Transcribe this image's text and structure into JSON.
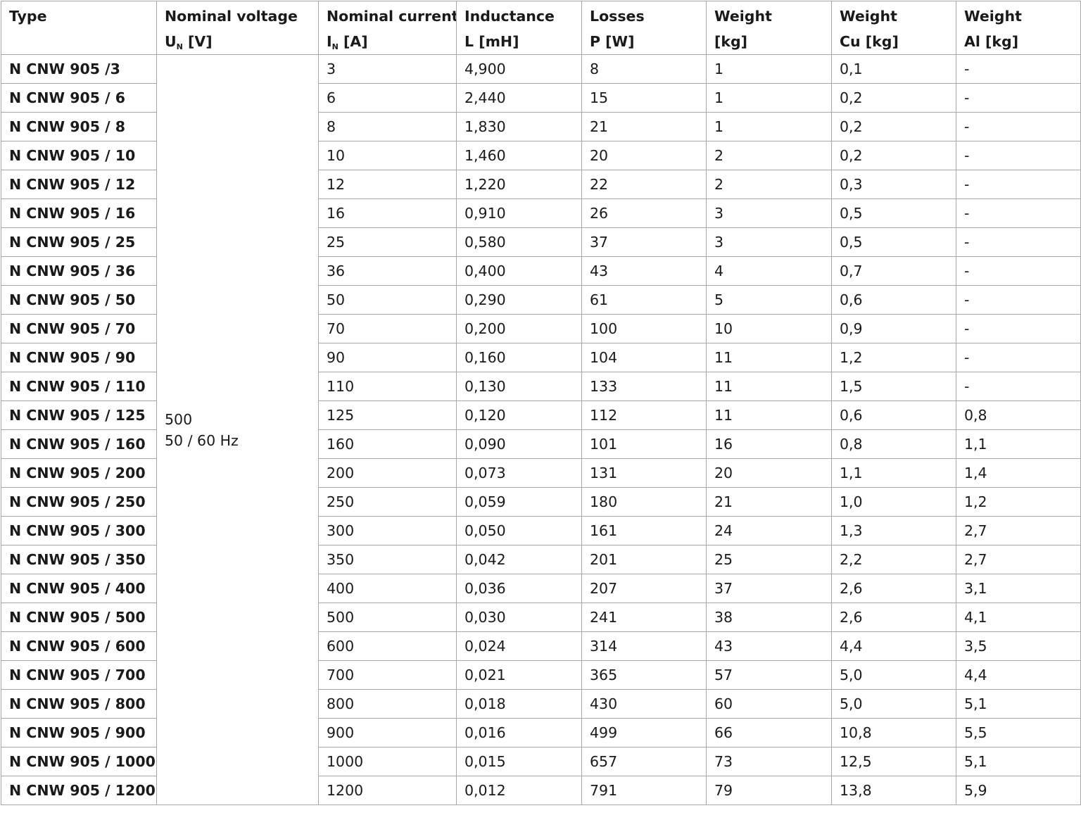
{
  "headers": [
    {
      "line1": "Type",
      "line2": "",
      "sub": "",
      "line2_rest": ""
    },
    {
      "line1": "Nominal voltage",
      "line2": "U",
      "sub": "N",
      "line2_rest": " [V]"
    },
    {
      "line1": "Nominal current",
      "line2": "I",
      "sub": "N",
      "line2_rest": " [A]"
    },
    {
      "line1": "Inductance",
      "line2": "L [mH]",
      "sub": "",
      "line2_rest": ""
    },
    {
      "line1": "Losses",
      "line2": "P [W]",
      "sub": "",
      "line2_rest": ""
    },
    {
      "line1": "Weight",
      "line2": "[kg]",
      "sub": "",
      "line2_rest": ""
    },
    {
      "line1": "Weight",
      "line2": "Cu [kg]",
      "sub": "",
      "line2_rest": ""
    },
    {
      "line1": "Weight",
      "line2": "Al [kg]",
      "sub": "",
      "line2_rest": ""
    }
  ],
  "voltage": {
    "value": "500",
    "frequency": "50 / 60 Hz"
  },
  "rows": [
    {
      "type": "N CNW 905 /3",
      "current": "3",
      "inductance": "4,900",
      "losses": "8",
      "weight": "1",
      "cu": "0,1",
      "al": "-"
    },
    {
      "type": "N CNW 905 / 6",
      "current": "6",
      "inductance": "2,440",
      "losses": "15",
      "weight": "1",
      "cu": "0,2",
      "al": "-"
    },
    {
      "type": "N CNW 905 / 8",
      "current": "8",
      "inductance": "1,830",
      "losses": "21",
      "weight": "1",
      "cu": "0,2",
      "al": "-"
    },
    {
      "type": "N CNW 905 / 10",
      "current": "10",
      "inductance": "1,460",
      "losses": "20",
      "weight": "2",
      "cu": "0,2",
      "al": "-"
    },
    {
      "type": "N CNW 905 / 12",
      "current": "12",
      "inductance": "1,220",
      "losses": "22",
      "weight": "2",
      "cu": "0,3",
      "al": "-"
    },
    {
      "type": "N CNW 905 / 16",
      "current": "16",
      "inductance": "0,910",
      "losses": "26",
      "weight": "3",
      "cu": "0,5",
      "al": "-"
    },
    {
      "type": "N CNW 905 / 25",
      "current": "25",
      "inductance": "0,580",
      "losses": "37",
      "weight": "3",
      "cu": "0,5",
      "al": "-"
    },
    {
      "type": "N CNW 905 / 36",
      "current": "36",
      "inductance": "0,400",
      "losses": "43",
      "weight": "4",
      "cu": "0,7",
      "al": "-"
    },
    {
      "type": "N CNW 905 / 50",
      "current": "50",
      "inductance": "0,290",
      "losses": "61",
      "weight": "5",
      "cu": "0,6",
      "al": "-"
    },
    {
      "type": "N CNW 905 / 70",
      "current": "70",
      "inductance": "0,200",
      "losses": "100",
      "weight": "10",
      "cu": "0,9",
      "al": "-"
    },
    {
      "type": "N CNW 905 / 90",
      "current": "90",
      "inductance": "0,160",
      "losses": "104",
      "weight": "11",
      "cu": "1,2",
      "al": "-"
    },
    {
      "type": "N CNW 905 / 110",
      "current": "110",
      "inductance": "0,130",
      "losses": "133",
      "weight": "11",
      "cu": "1,5",
      "al": "-"
    },
    {
      "type": "N CNW 905 / 125",
      "current": "125",
      "inductance": "0,120",
      "losses": "112",
      "weight": "11",
      "cu": "0,6",
      "al": "0,8"
    },
    {
      "type": "N CNW 905 / 160",
      "current": "160",
      "inductance": "0,090",
      "losses": "101",
      "weight": "16",
      "cu": "0,8",
      "al": "1,1"
    },
    {
      "type": "N CNW 905 / 200",
      "current": "200",
      "inductance": "0,073",
      "losses": "131",
      "weight": "20",
      "cu": "1,1",
      "al": "1,4"
    },
    {
      "type": "N CNW 905 / 250",
      "current": "250",
      "inductance": "0,059",
      "losses": "180",
      "weight": "21",
      "cu": "1,0",
      "al": "1,2"
    },
    {
      "type": "N CNW 905 / 300",
      "current": "300",
      "inductance": "0,050",
      "losses": "161",
      "weight": "24",
      "cu": "1,3",
      "al": "2,7"
    },
    {
      "type": "N CNW 905 / 350",
      "current": "350",
      "inductance": "0,042",
      "losses": "201",
      "weight": "25",
      "cu": "2,2",
      "al": "2,7"
    },
    {
      "type": "N CNW 905 / 400",
      "current": "400",
      "inductance": "0,036",
      "losses": "207",
      "weight": "37",
      "cu": "2,6",
      "al": "3,1"
    },
    {
      "type": "N CNW 905 / 500",
      "current": "500",
      "inductance": "0,030",
      "losses": "241",
      "weight": "38",
      "cu": "2,6",
      "al": "4,1"
    },
    {
      "type": "N CNW 905 / 600",
      "current": "600",
      "inductance": "0,024",
      "losses": "314",
      "weight": "43",
      "cu": "4,4",
      "al": "3,5"
    },
    {
      "type": "N CNW 905 / 700",
      "current": "700",
      "inductance": "0,021",
      "losses": "365",
      "weight": "57",
      "cu": "5,0",
      "al": "4,4"
    },
    {
      "type": "N CNW 905 / 800",
      "current": "800",
      "inductance": "0,018",
      "losses": "430",
      "weight": "60",
      "cu": "5,0",
      "al": "5,1"
    },
    {
      "type": "N CNW 905 / 900",
      "current": "900",
      "inductance": "0,016",
      "losses": "499",
      "weight": "66",
      "cu": "10,8",
      "al": "5,5"
    },
    {
      "type": "N CNW 905 / 1000",
      "current": "1000",
      "inductance": "0,015",
      "losses": "657",
      "weight": "73",
      "cu": "12,5",
      "al": "5,1"
    },
    {
      "type": "N CNW 905 / 1200",
      "current": "1200",
      "inductance": "0,012",
      "losses": "791",
      "weight": "79",
      "cu": "13,8",
      "al": "5,9"
    }
  ]
}
